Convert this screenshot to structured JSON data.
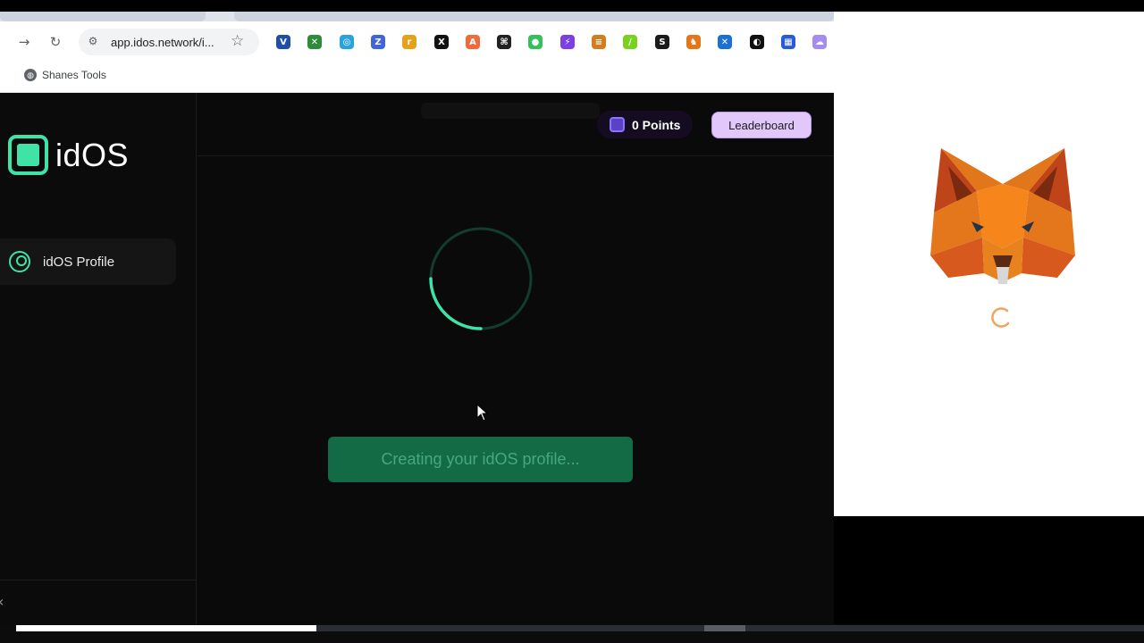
{
  "browser": {
    "url": "app.idos.network/i...",
    "bookmark": "Shanes Tools",
    "extensions": [
      {
        "icon": "vivaldi-icon",
        "glyph": "V",
        "color": "#1f4ea8"
      },
      {
        "icon": "cross-extension-icon",
        "glyph": "✕",
        "color": "#2e8b3a"
      },
      {
        "icon": "circle-arrow-extension-icon",
        "glyph": "◎",
        "color": "#29a3df"
      },
      {
        "icon": "z-extension-icon",
        "glyph": "Z",
        "color": "#3f66d9"
      },
      {
        "icon": "r-extension-icon",
        "glyph": "r",
        "color": "#e4a11b"
      },
      {
        "icon": "x-extension-icon",
        "glyph": "X",
        "color": "#111111"
      },
      {
        "icon": "a-extension-icon",
        "glyph": "A",
        "color": "#f06a3a"
      },
      {
        "icon": "dark-grid-extension-icon",
        "glyph": "⌘",
        "color": "#222222"
      },
      {
        "icon": "frog-extension-icon",
        "glyph": "●",
        "color": "#34c15a"
      },
      {
        "icon": "purple-extension-icon",
        "glyph": "⚡",
        "color": "#7b3fe4"
      },
      {
        "icon": "stack-extension-icon",
        "glyph": "≡",
        "color": "#d27d1e"
      },
      {
        "icon": "leaf-extension-icon",
        "glyph": "/",
        "color": "#7ad11f"
      },
      {
        "icon": "s-extension-icon",
        "glyph": "S",
        "color": "#1a1a1a"
      },
      {
        "icon": "metamask-extension-icon",
        "glyph": "♞",
        "color": "#e2761b"
      },
      {
        "icon": "blue-x-extension-icon",
        "glyph": "✕",
        "color": "#1d6fd8"
      },
      {
        "icon": "circle-extension-icon",
        "glyph": "◐",
        "color": "#111111"
      },
      {
        "icon": "grid-extension-icon",
        "glyph": "▦",
        "color": "#2a5bd7"
      },
      {
        "icon": "cloud-extension-icon",
        "glyph": "☁",
        "color": "#a68cf0"
      }
    ]
  },
  "app": {
    "logo_text": "idOS",
    "nav": [
      {
        "label": "idOS Profile"
      }
    ],
    "points_label": "0 Points",
    "leaderboard_label": "Leaderboard",
    "creating_label": "Creating your idOS profile...",
    "accent_color": "#3fe2a7",
    "button_color": "#136b46",
    "leaderboard_color": "#e2c7fb"
  }
}
